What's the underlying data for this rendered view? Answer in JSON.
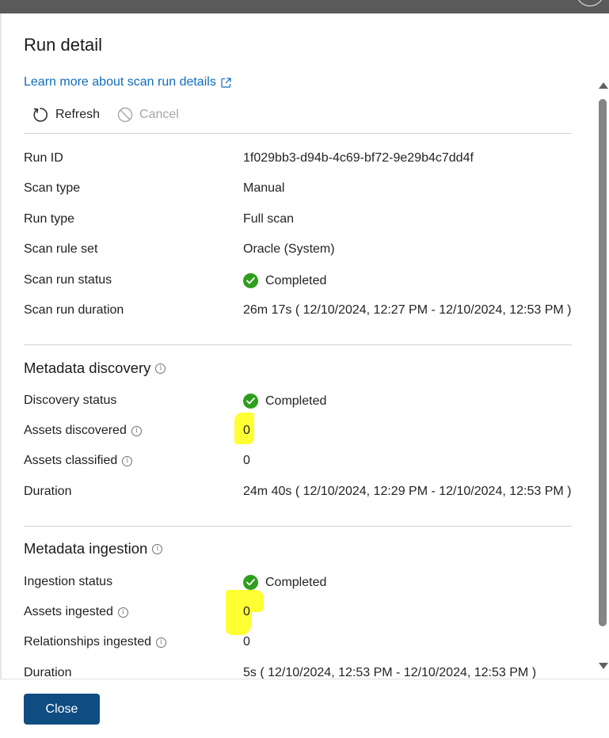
{
  "panel": {
    "title": "Run detail",
    "learn_link": "Learn more about scan run details"
  },
  "toolbar": {
    "refresh_label": "Refresh",
    "cancel_label": "Cancel"
  },
  "run_info": [
    {
      "label": "Run ID",
      "value": "1f029bb3-d94b-4c69-bf72-9e29b4c7dd4f"
    },
    {
      "label": "Scan type",
      "value": "Manual"
    },
    {
      "label": "Run type",
      "value": "Full scan"
    },
    {
      "label": "Scan rule set",
      "value": "Oracle (System)"
    },
    {
      "label": "Scan run status",
      "value": "Completed",
      "status_icon": "check-circle-icon"
    },
    {
      "label": "Scan run duration",
      "value": "26m 17s ( 12/10/2024, 12:27 PM - 12/10/2024, 12:53 PM )"
    }
  ],
  "discovery": {
    "title": "Metadata discovery",
    "rows": [
      {
        "label": "Discovery status",
        "value": "Completed",
        "status_icon": "check-circle-icon"
      },
      {
        "label": "Assets discovered",
        "value": "0",
        "info": true
      },
      {
        "label": "Assets classified",
        "value": "0",
        "info": true
      },
      {
        "label": "Duration",
        "value": "24m 40s ( 12/10/2024, 12:29 PM - 12/10/2024, 12:53 PM )"
      }
    ]
  },
  "ingestion": {
    "title": "Metadata ingestion",
    "rows": [
      {
        "label": "Ingestion status",
        "value": "Completed",
        "status_icon": "check-circle-icon"
      },
      {
        "label": "Assets ingested",
        "value": "0",
        "info": true
      },
      {
        "label": "Relationships ingested",
        "value": "0",
        "info": true
      },
      {
        "label": "Duration",
        "value": "5s ( 12/10/2024, 12:53 PM - 12/10/2024, 12:53 PM )"
      }
    ]
  },
  "footer": {
    "close_label": "Close"
  },
  "colors": {
    "primary_button": "#0f4c81",
    "link": "#0f6cbd",
    "success": "#2f9e1f",
    "highlight": "#ffff33"
  }
}
